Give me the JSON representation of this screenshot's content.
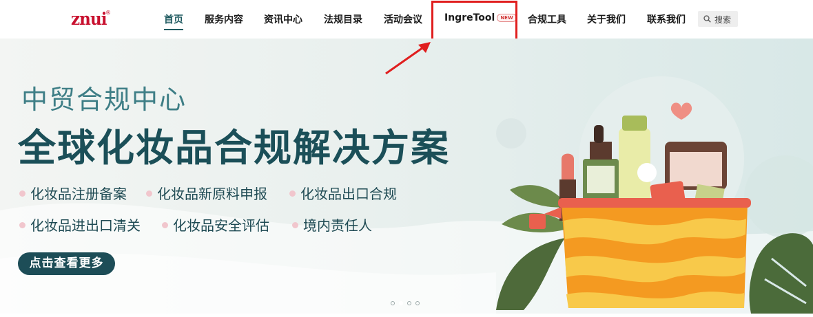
{
  "header": {
    "logo_text": "znui",
    "logo_mark": "®",
    "nav": [
      {
        "label": "首页",
        "active": true
      },
      {
        "label": "服务内容"
      },
      {
        "label": "资讯中心"
      },
      {
        "label": "法规目录"
      },
      {
        "label": "活动会议"
      },
      {
        "label": "IngreTool",
        "badge": "NEW"
      },
      {
        "label": "合规工具"
      },
      {
        "label": "关于我们"
      },
      {
        "label": "联系我们"
      }
    ],
    "search_label": "搜索",
    "search_icon": "search-icon"
  },
  "banner": {
    "subtitle": "中贸合规中心",
    "title": "全球化妆品合规解决方案",
    "services": [
      "化妆品注册备案",
      "化妆品新原料申报",
      "化妆品出口合规",
      "化妆品进出口清关",
      "化妆品安全评估",
      "境内责任人"
    ],
    "cta_label": "点击查看更多",
    "slides_total": 4,
    "slide_active": 2
  },
  "colors": {
    "brand_red": "#c8102e",
    "nav_active": "#1f5a60",
    "title_dark": "#1b4f58",
    "subtitle_teal": "#3e7e86",
    "annotation_red": "#e01e1e",
    "bag_orange": "#f49a21",
    "bag_yellow": "#f8c94a"
  }
}
